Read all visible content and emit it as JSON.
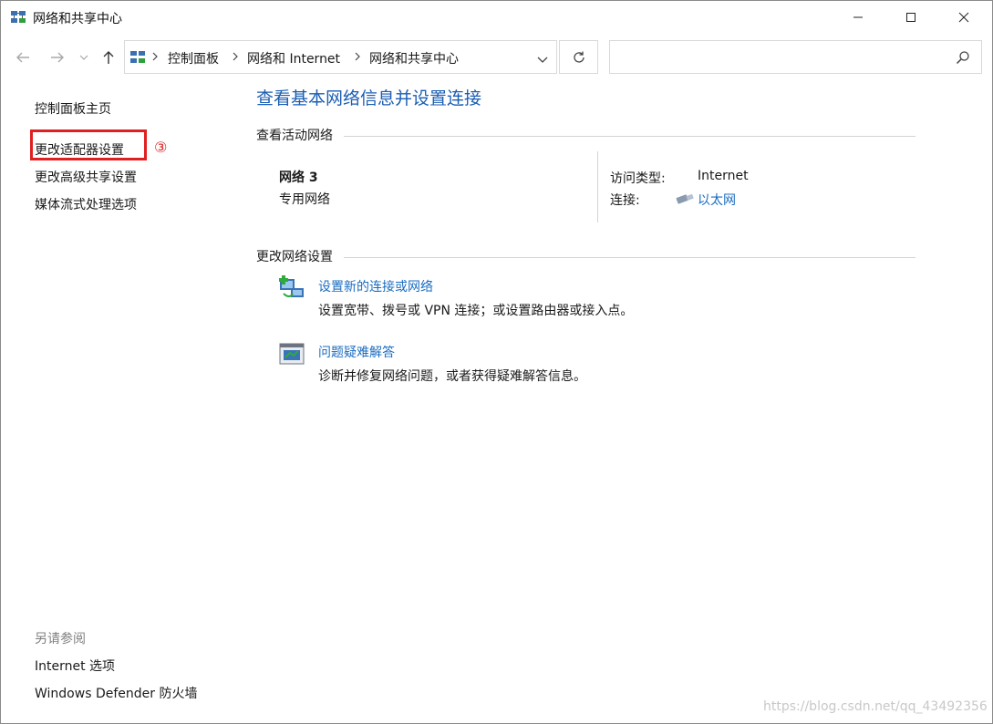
{
  "window": {
    "title": "网络和共享中心",
    "icon": "network-center-icon"
  },
  "navbar": {
    "breadcrumb": [
      "控制面板",
      "网络和 Internet",
      "网络和共享中心"
    ],
    "search_placeholder": ""
  },
  "sidebar": {
    "home": "控制面板主页",
    "items": [
      "更改适配器设置",
      "更改高级共享设置",
      "媒体流式处理选项"
    ],
    "see_also_title": "另请参阅",
    "see_also": [
      "Internet 选项",
      "Windows Defender 防火墙"
    ]
  },
  "annotation": {
    "step_label": "③",
    "color": "#e02020"
  },
  "main": {
    "title": "查看基本网络信息并设置连接",
    "active_networks_heading": "查看活动网络",
    "network": {
      "name": "网络 3",
      "category": "专用网络",
      "access_type_label": "访问类型:",
      "access_type_value": "Internet",
      "connections_label": "连接:",
      "connections_value": "以太网"
    },
    "change_settings_heading": "更改网络设置",
    "tasks": [
      {
        "link": "设置新的连接或网络",
        "description": "设置宽带、拨号或 VPN 连接；或设置路由器或接入点。",
        "icon": "new-connection-icon"
      },
      {
        "link": "问题疑难解答",
        "description": "诊断并修复网络问题，或者获得疑难解答信息。",
        "icon": "troubleshoot-icon"
      }
    ]
  },
  "watermark": "https://blog.csdn.net/qq_43492356",
  "colors": {
    "link": "#1b6dc1",
    "title": "#1b5eb3",
    "highlight": "#e02020"
  }
}
